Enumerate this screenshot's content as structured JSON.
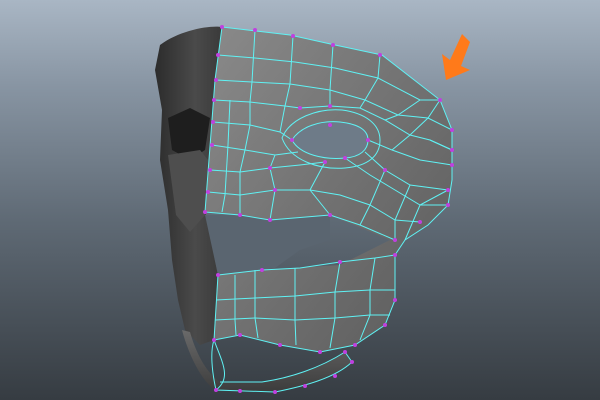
{
  "viewport": {
    "background_top": "#a9b6c4",
    "background_bottom": "#363c42"
  },
  "mesh": {
    "face_color": "#5f5f5f",
    "face_light": "#7d7d7d",
    "side_color": "#3a3a3a",
    "wire_color": "#5ff2f4",
    "vertex_color": "#c040e0"
  },
  "annotation": {
    "arrow_color": "#ff7a1a",
    "icon": "arrow-down-left"
  }
}
